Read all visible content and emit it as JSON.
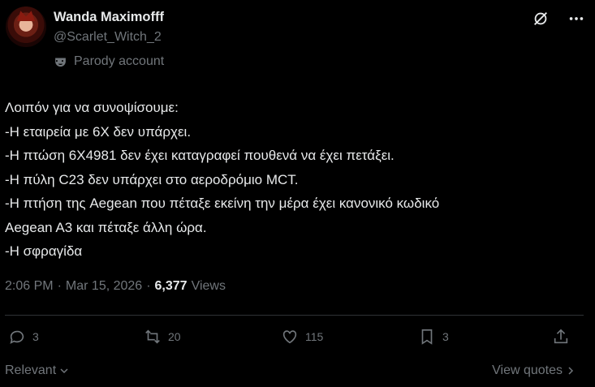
{
  "author": {
    "name": "Wanda Maximofff",
    "handle": "@Scarlet_Witch_2",
    "label": "Parody account"
  },
  "tweet": {
    "lines": [
      "Λοιπόν για να συνοψίσουμε:",
      "-Η εταιρεία με 6Χ δεν υπάρχει.",
      "-Η πτώση 6X4981 δεν έχει καταγραφεί πουθενά να έχει πετάξει.",
      "-Η πύλη C23 δεν υπάρχει στο αεροδρόμιο MCT.",
      "-Η πτήση της Aegean που πέταξε εκείνη την μέρα έχει κανονικό κωδικό",
      "Aegean A3 και πέταξε άλλη ώρα.",
      "-Η σφραγίδα"
    ],
    "time": "2:06 PM",
    "date": "Mar 15, 2026",
    "dot": "·",
    "views_count": "6,377",
    "views_label": "Views"
  },
  "actions": {
    "replies": "3",
    "reposts": "20",
    "likes": "115",
    "bookmarks": "3"
  },
  "footer": {
    "sort_label": "Relevant",
    "quotes_label": "View quotes"
  },
  "colors": {
    "background": "#000000",
    "text": "#e7e9ea",
    "muted": "#71767b",
    "divider": "#2f3336"
  }
}
